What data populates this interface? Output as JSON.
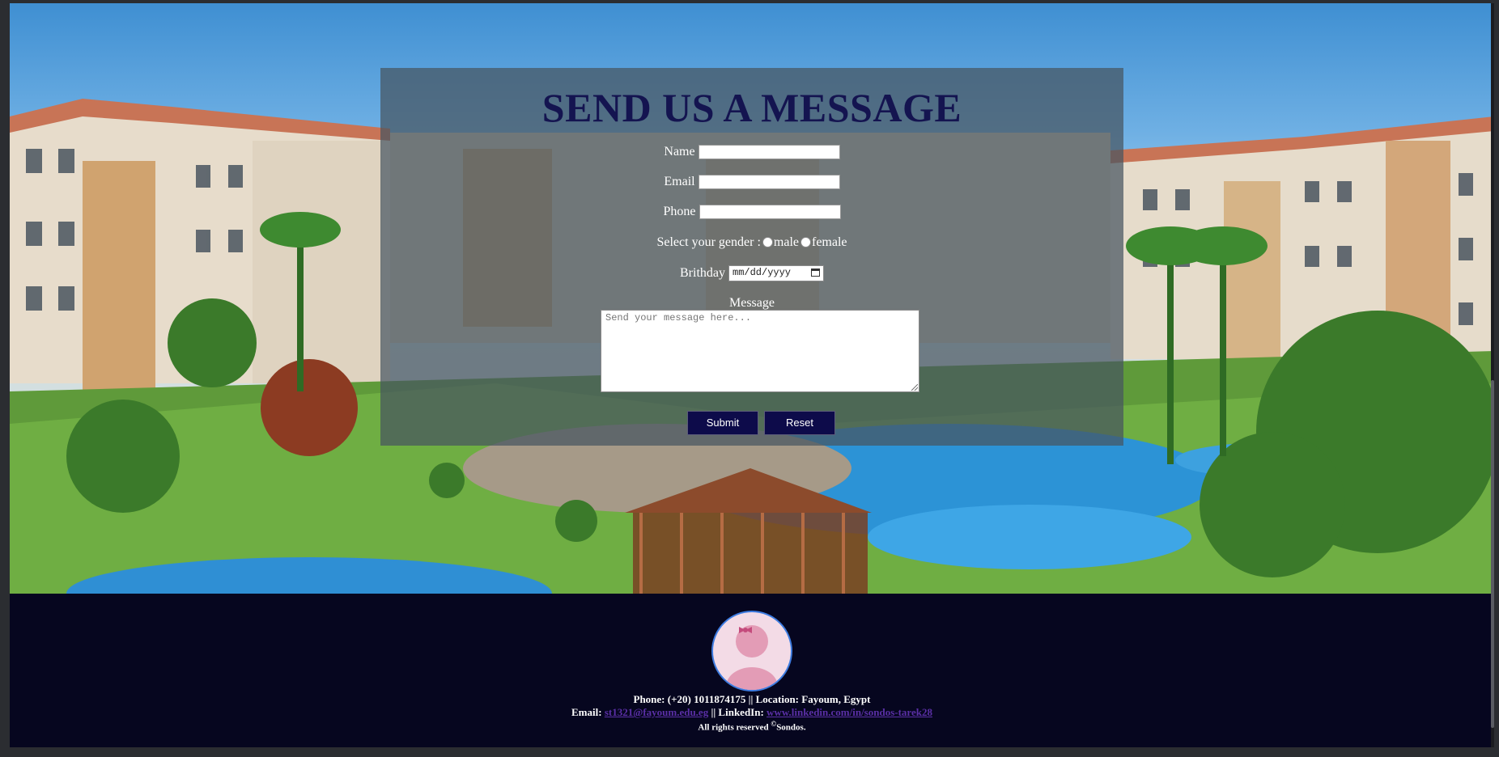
{
  "form": {
    "title": "SEND US A MESSAGE",
    "name_label": "Name",
    "email_label": "Email",
    "phone_label": "Phone",
    "gender_label": "Select your gender :",
    "gender_options": [
      "male",
      "female"
    ],
    "birthday_label": "Brithday",
    "birthday_placeholder": "mm/dd/yyyy",
    "message_label": "Message",
    "message_placeholder": "Send your message here...",
    "submit_label": "Submit",
    "reset_label": "Reset"
  },
  "footer": {
    "contact_line": "Phone: (+20) 1011874175 || Location: Fayoum, Egypt",
    "email_prefix": "Email:",
    "email": "st1321@fayoum.edu.eg",
    "linkedin_prefix": "|| LinkedIn:",
    "linkedin": "www.linkedin.com/in/sondos-tarek28",
    "rights_text": "All rights reserved",
    "copyright_symbol": "©",
    "owner": "Sondos."
  },
  "colors": {
    "title": "#141450",
    "button_bg": "#0d0b4a",
    "footer_bg": "#06061f",
    "link": "#5a2fa6"
  }
}
